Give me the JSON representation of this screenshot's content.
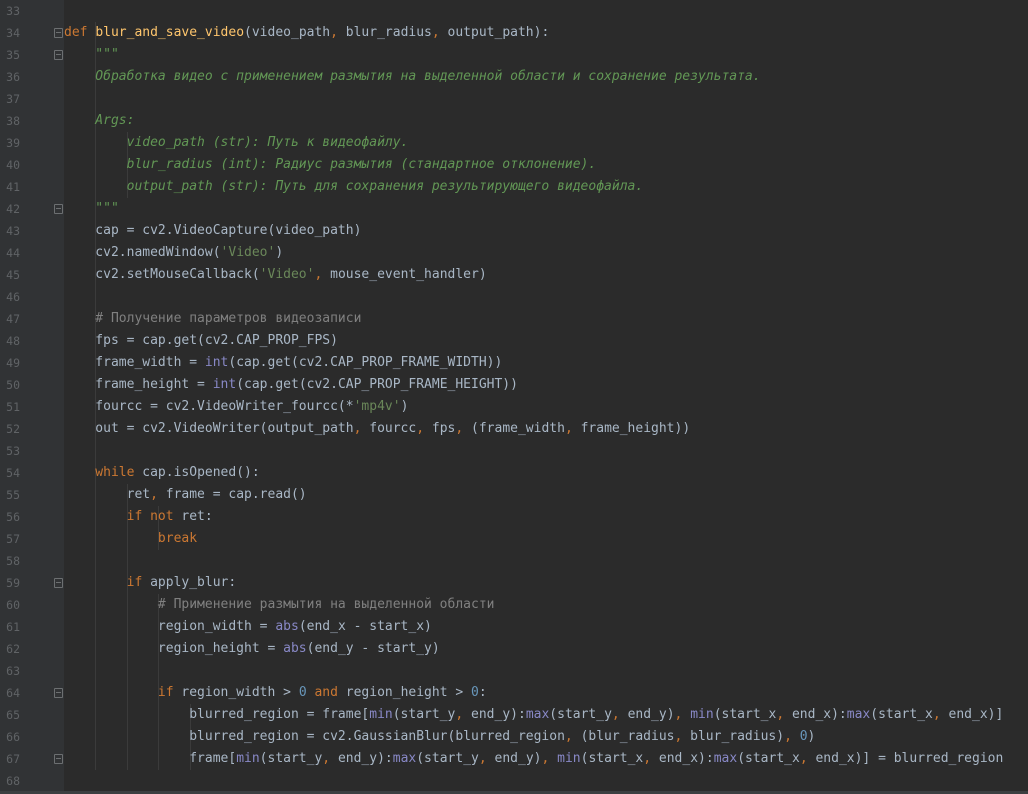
{
  "editor": {
    "colors": {
      "background": "#2b2b2b",
      "gutter": "#313335",
      "keyword": "#cc7832",
      "function": "#ffc66d",
      "builtin": "#8888c6",
      "string": "#6a8759",
      "number": "#6897bb",
      "comment": "#808080",
      "docstring": "#629755",
      "text": "#a9b7c6"
    },
    "lines": [
      {
        "n": "33",
        "tokens": []
      },
      {
        "n": "34",
        "tokens": [
          [
            "kw",
            "def "
          ],
          [
            "fn",
            "blur_and_save_video"
          ],
          [
            "plain",
            "(video_path"
          ],
          [
            "kw",
            ", "
          ],
          [
            "plain",
            "blur_radius"
          ],
          [
            "kw",
            ", "
          ],
          [
            "plain",
            "output_path):"
          ]
        ]
      },
      {
        "n": "35",
        "tokens": [
          [
            "doc",
            "    \"\"\""
          ]
        ]
      },
      {
        "n": "36",
        "tokens": [
          [
            "doc",
            "    Обработка видео с применением размытия на выделенной области и сохранение результата."
          ]
        ]
      },
      {
        "n": "37",
        "tokens": []
      },
      {
        "n": "38",
        "tokens": [
          [
            "doc",
            "    Args:"
          ]
        ]
      },
      {
        "n": "39",
        "tokens": [
          [
            "doc",
            "        video_path (str): Путь к видеофайлу."
          ]
        ]
      },
      {
        "n": "40",
        "tokens": [
          [
            "doc",
            "        blur_radius (int): Радиус размытия (стандартное отклонение)."
          ]
        ]
      },
      {
        "n": "41",
        "tokens": [
          [
            "doc",
            "        output_path (str): Путь для сохранения результирующего видеофайла."
          ]
        ]
      },
      {
        "n": "42",
        "tokens": [
          [
            "doc",
            "    \"\"\""
          ]
        ]
      },
      {
        "n": "43",
        "tokens": [
          [
            "plain",
            "    cap = cv2.VideoCapture(video_path)"
          ]
        ]
      },
      {
        "n": "44",
        "tokens": [
          [
            "plain",
            "    cv2.namedWindow("
          ],
          [
            "str",
            "'Video'"
          ],
          [
            "plain",
            ")"
          ]
        ]
      },
      {
        "n": "45",
        "tokens": [
          [
            "plain",
            "    cv2.setMouseCallback("
          ],
          [
            "str",
            "'Video'"
          ],
          [
            "kw",
            ", "
          ],
          [
            "plain",
            "mouse_event_handler)"
          ]
        ]
      },
      {
        "n": "46",
        "tokens": []
      },
      {
        "n": "47",
        "tokens": [
          [
            "cmt",
            "    # Получение параметров видеозаписи"
          ]
        ]
      },
      {
        "n": "48",
        "tokens": [
          [
            "plain",
            "    fps = cap.get(cv2.CAP_PROP_FPS)"
          ]
        ]
      },
      {
        "n": "49",
        "tokens": [
          [
            "plain",
            "    frame_width = "
          ],
          [
            "bi",
            "int"
          ],
          [
            "plain",
            "(cap.get(cv2.CAP_PROP_FRAME_WIDTH))"
          ]
        ]
      },
      {
        "n": "50",
        "tokens": [
          [
            "plain",
            "    frame_height = "
          ],
          [
            "bi",
            "int"
          ],
          [
            "plain",
            "(cap.get(cv2.CAP_PROP_FRAME_HEIGHT))"
          ]
        ]
      },
      {
        "n": "51",
        "tokens": [
          [
            "plain",
            "    fourcc = cv2.VideoWriter_fourcc(*"
          ],
          [
            "str",
            "'mp4v'"
          ],
          [
            "plain",
            ")"
          ]
        ]
      },
      {
        "n": "52",
        "tokens": [
          [
            "plain",
            "    out = cv2.VideoWriter(output_path"
          ],
          [
            "kw",
            ", "
          ],
          [
            "plain",
            "fourcc"
          ],
          [
            "kw",
            ", "
          ],
          [
            "plain",
            "fps"
          ],
          [
            "kw",
            ", "
          ],
          [
            "plain",
            "(frame_width"
          ],
          [
            "kw",
            ", "
          ],
          [
            "plain",
            "frame_height))"
          ]
        ]
      },
      {
        "n": "53",
        "tokens": []
      },
      {
        "n": "54",
        "tokens": [
          [
            "kw",
            "    while "
          ],
          [
            "plain",
            "cap.isOpened():"
          ]
        ]
      },
      {
        "n": "55",
        "tokens": [
          [
            "plain",
            "        ret"
          ],
          [
            "kw",
            ", "
          ],
          [
            "plain",
            "frame = cap.read()"
          ]
        ]
      },
      {
        "n": "56",
        "tokens": [
          [
            "kw",
            "        if not "
          ],
          [
            "plain",
            "ret:"
          ]
        ]
      },
      {
        "n": "57",
        "tokens": [
          [
            "kw",
            "            break"
          ]
        ]
      },
      {
        "n": "58",
        "tokens": []
      },
      {
        "n": "59",
        "tokens": [
          [
            "kw",
            "        if "
          ],
          [
            "plain",
            "apply_blur:"
          ]
        ]
      },
      {
        "n": "60",
        "tokens": [
          [
            "cmt",
            "            # Применение размытия на выделенной области"
          ]
        ]
      },
      {
        "n": "61",
        "tokens": [
          [
            "plain",
            "            region_width = "
          ],
          [
            "bi",
            "abs"
          ],
          [
            "plain",
            "(end_x - start_x)"
          ]
        ]
      },
      {
        "n": "62",
        "tokens": [
          [
            "plain",
            "            region_height = "
          ],
          [
            "bi",
            "abs"
          ],
          [
            "plain",
            "(end_y - start_y)"
          ]
        ]
      },
      {
        "n": "63",
        "tokens": []
      },
      {
        "n": "64",
        "tokens": [
          [
            "kw",
            "            if "
          ],
          [
            "plain",
            "region_width > "
          ],
          [
            "num",
            "0"
          ],
          [
            "kw",
            " and "
          ],
          [
            "plain",
            "region_height > "
          ],
          [
            "num",
            "0"
          ],
          [
            "plain",
            ":"
          ]
        ]
      },
      {
        "n": "65",
        "tokens": [
          [
            "plain",
            "                blurred_region = frame["
          ],
          [
            "bi",
            "min"
          ],
          [
            "plain",
            "(start_y"
          ],
          [
            "kw",
            ", "
          ],
          [
            "plain",
            "end_y):"
          ],
          [
            "bi",
            "max"
          ],
          [
            "plain",
            "(start_y"
          ],
          [
            "kw",
            ", "
          ],
          [
            "plain",
            "end_y)"
          ],
          [
            "kw",
            ", "
          ],
          [
            "bi",
            "min"
          ],
          [
            "plain",
            "(start_x"
          ],
          [
            "kw",
            ", "
          ],
          [
            "plain",
            "end_x):"
          ],
          [
            "bi",
            "max"
          ],
          [
            "plain",
            "(start_x"
          ],
          [
            "kw",
            ", "
          ],
          [
            "plain",
            "end_x)]"
          ]
        ]
      },
      {
        "n": "66",
        "tokens": [
          [
            "plain",
            "                blurred_region = cv2.GaussianBlur(blurred_region"
          ],
          [
            "kw",
            ", "
          ],
          [
            "plain",
            "(blur_radius"
          ],
          [
            "kw",
            ", "
          ],
          [
            "plain",
            "blur_radius)"
          ],
          [
            "kw",
            ", "
          ],
          [
            "num",
            "0"
          ],
          [
            "plain",
            ")"
          ]
        ]
      },
      {
        "n": "67",
        "tokens": [
          [
            "plain",
            "                frame["
          ],
          [
            "bi",
            "min"
          ],
          [
            "plain",
            "(start_y"
          ],
          [
            "kw",
            ", "
          ],
          [
            "plain",
            "end_y):"
          ],
          [
            "bi",
            "max"
          ],
          [
            "plain",
            "(start_y"
          ],
          [
            "kw",
            ", "
          ],
          [
            "plain",
            "end_y)"
          ],
          [
            "kw",
            ", "
          ],
          [
            "bi",
            "min"
          ],
          [
            "plain",
            "(start_x"
          ],
          [
            "kw",
            ", "
          ],
          [
            "plain",
            "end_x):"
          ],
          [
            "bi",
            "max"
          ],
          [
            "plain",
            "(start_x"
          ],
          [
            "kw",
            ", "
          ],
          [
            "plain",
            "end_x)] = blurred_region"
          ]
        ]
      },
      {
        "n": "68",
        "tokens": []
      }
    ],
    "folds": [
      "34",
      "35",
      "42",
      "59",
      "64",
      "67"
    ]
  }
}
